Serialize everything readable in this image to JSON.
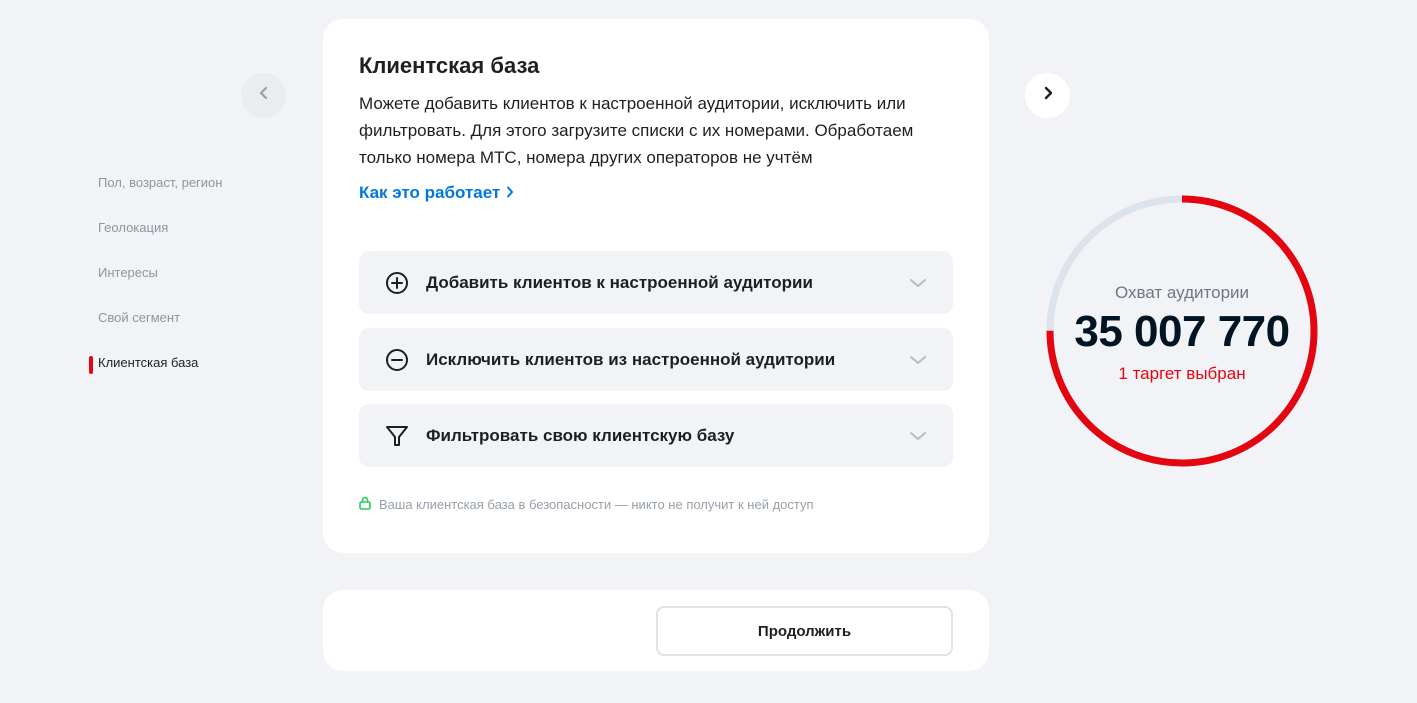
{
  "side_nav": {
    "items": [
      {
        "label": "Пол, возраст, регион"
      },
      {
        "label": "Геолокация"
      },
      {
        "label": "Интересы"
      },
      {
        "label": "Свой сегмент"
      },
      {
        "label": "Клиентская база",
        "active": true
      }
    ]
  },
  "arrows": {
    "prev_icon": "chevron-left-icon",
    "next_icon": "chevron-right-icon"
  },
  "card": {
    "title": "Клиентская база",
    "description": "Можете добавить клиентов к настроенной аудитории, исключить или фильтровать. Для этого загрузите списки с их номерами. Обработаем только номера МТС, номера других операторов не учтём",
    "how_link": "Как это работает",
    "accordions": [
      {
        "label": "Добавить клиентов к настроенной аудитории",
        "icon": "plus-circle-icon"
      },
      {
        "label": "Исключить клиентов из настроенной аудитории",
        "icon": "minus-circle-icon"
      },
      {
        "label": "Фильтровать свою клиентскую базу",
        "icon": "filter-icon"
      }
    ],
    "secure_note": "Ваша клиентская база в безопасности — никто не получит к ней доступ"
  },
  "bottom": {
    "continue_label": "Продолжить"
  },
  "reach": {
    "label": "Охват аудитории",
    "value": "35 007 770",
    "sub": "1 таргет выбран",
    "fill_fraction": 0.75
  },
  "colors": {
    "accent": "#e30611",
    "link": "#0077db",
    "track": "#dde3ea"
  }
}
